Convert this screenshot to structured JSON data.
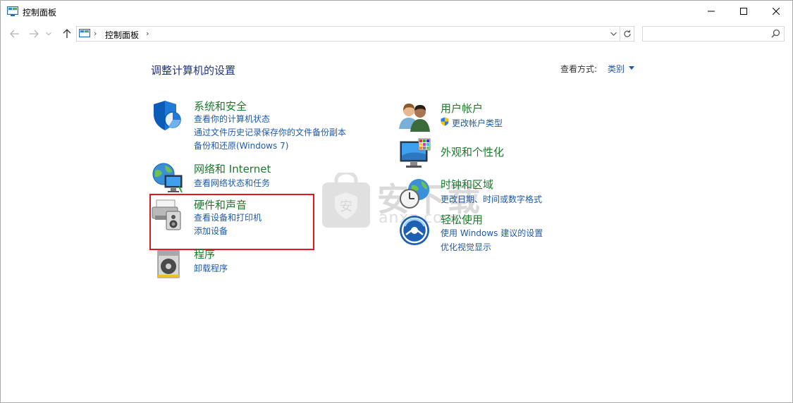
{
  "window": {
    "title": "控制面板"
  },
  "nav": {
    "breadcrumb": "控制面板",
    "search_placeholder": ""
  },
  "main": {
    "heading": "调整计算机的设置",
    "view_by_label": "查看方式:",
    "view_by_value": "类别"
  },
  "categories": {
    "system": {
      "title": "系统和安全",
      "links": [
        "查看你的计算机状态",
        "通过文件历史记录保存你的文件备份副本",
        "备份和还原(Windows 7)"
      ]
    },
    "network": {
      "title": "网络和 Internet",
      "links": [
        "查看网络状态和任务"
      ]
    },
    "hardware": {
      "title": "硬件和声音",
      "links": [
        "查看设备和打印机",
        "添加设备"
      ]
    },
    "programs": {
      "title": "程序",
      "links": [
        "卸载程序"
      ]
    },
    "users": {
      "title": "用户帐户",
      "links": [
        "更改帐户类型"
      ]
    },
    "appearance": {
      "title": "外观和个性化",
      "links": []
    },
    "clock": {
      "title": "时钟和区域",
      "links": [
        "更改日期、时间或数字格式"
      ]
    },
    "ease": {
      "title": "轻松使用",
      "links": [
        "使用 Windows 建议的设置",
        "优化视觉显示"
      ]
    }
  },
  "watermark": {
    "text": "安下载",
    "sub": "anxz.com"
  },
  "colors": {
    "heading": "#1e3287",
    "category_title": "#1a7a2a",
    "link": "#1e5aa8",
    "highlight": "#e0191e"
  }
}
